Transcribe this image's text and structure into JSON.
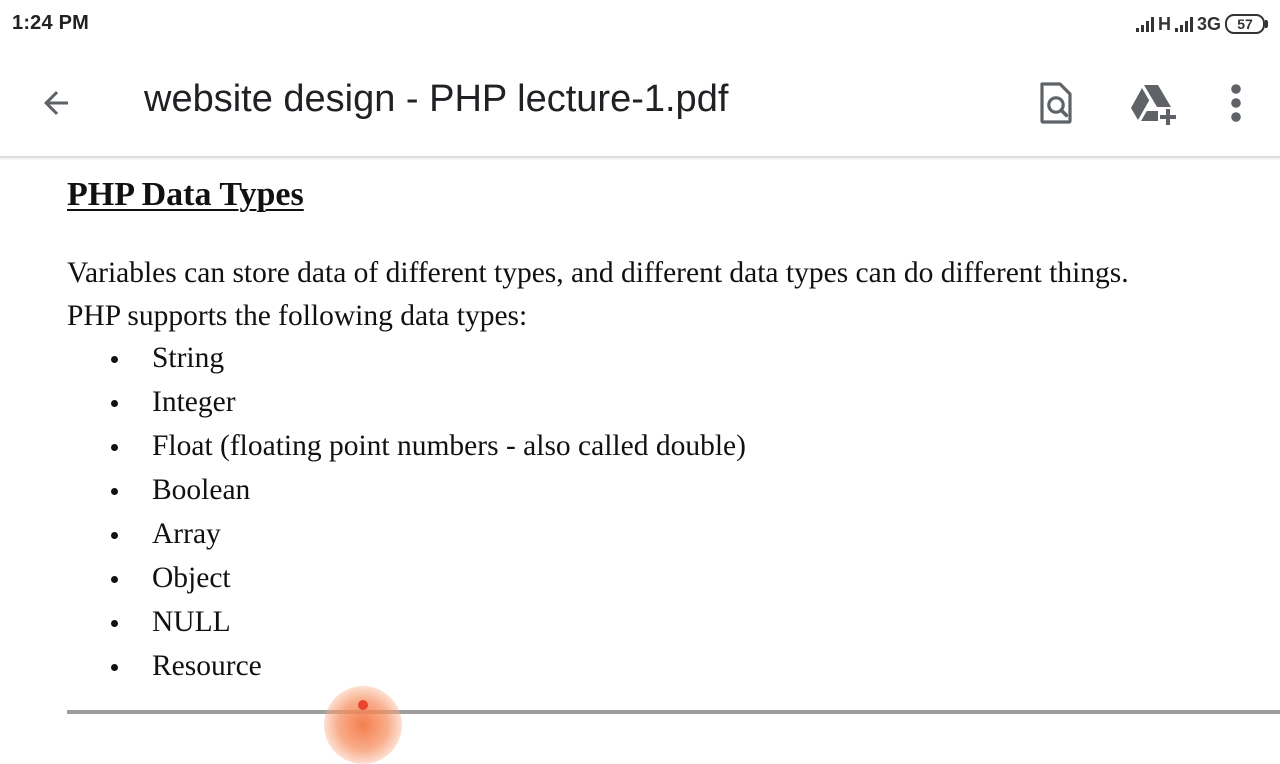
{
  "status_bar": {
    "time": "1:24 PM",
    "network_1": "H",
    "network_2": "3G",
    "battery": "57"
  },
  "app_bar": {
    "title": "website design - PHP lecture-1.pdf",
    "icons": {
      "back": "arrow-back-icon",
      "search_document": "find-in-page-icon",
      "add_to_drive": "add-to-drive-icon",
      "more": "more-vert-icon"
    }
  },
  "document": {
    "heading": "PHP Data Types",
    "paragraph_line_1": "Variables can store data of different types, and different data types can do different things.",
    "paragraph_line_2": "PHP supports the following data types:",
    "data_types": [
      "String",
      "Integer",
      "Float (floating point numbers - also called double)",
      "Boolean",
      "Array",
      "Object",
      "NULL",
      "Resource"
    ]
  },
  "colors": {
    "title_text": "#202124",
    "icon_gray": "#5f6368",
    "touch_marker": "#f47846"
  }
}
